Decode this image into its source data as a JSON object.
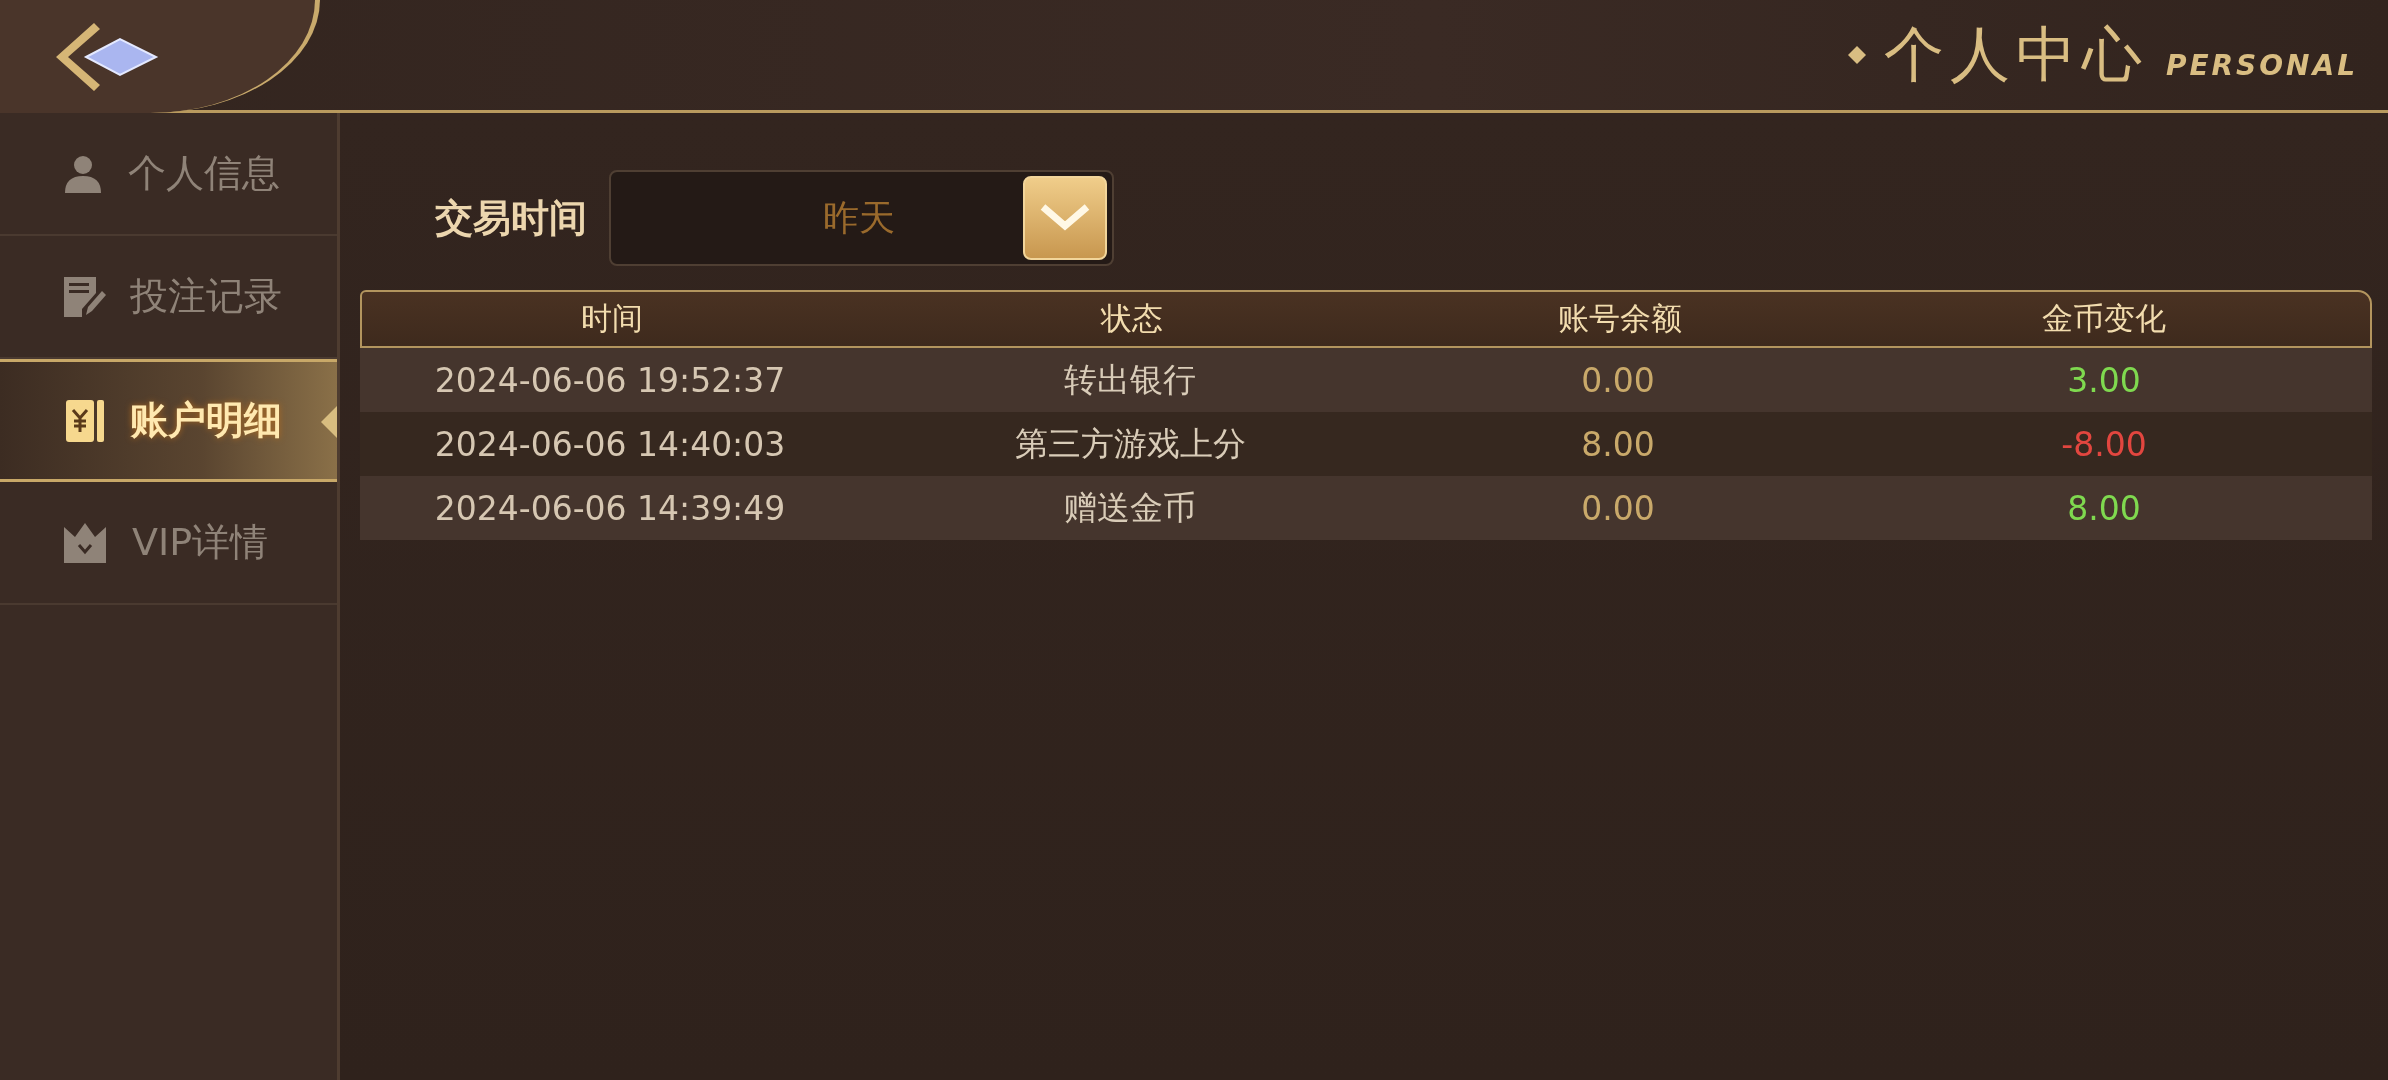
{
  "header": {
    "title": "个人中心",
    "subtitle": "PERSONAL"
  },
  "sidebar": {
    "items": [
      {
        "label": "个人信息",
        "selected": false
      },
      {
        "label": "投注记录",
        "selected": false
      },
      {
        "label": "账户明细",
        "selected": true
      },
      {
        "label": "VIP详情",
        "selected": false
      }
    ]
  },
  "filter": {
    "label": "交易时间",
    "value": "昨天"
  },
  "table": {
    "columns": [
      "时间",
      "状态",
      "账号余额",
      "金币变化"
    ],
    "rows": [
      {
        "time": "2024-06-06 19:52:37",
        "status": "转出银行",
        "balance": "0.00",
        "change": {
          "text": "3.00",
          "color": "#7fd94f"
        }
      },
      {
        "time": "2024-06-06 14:40:03",
        "status": "第三方游戏上分",
        "balance": "8.00",
        "change": {
          "text": "-8.00",
          "color": "#e2463f"
        }
      },
      {
        "time": "2024-06-06 14:39:49",
        "status": "赠送金币",
        "balance": "0.00",
        "change": {
          "text": "8.00",
          "color": "#7fd94f"
        }
      }
    ]
  }
}
